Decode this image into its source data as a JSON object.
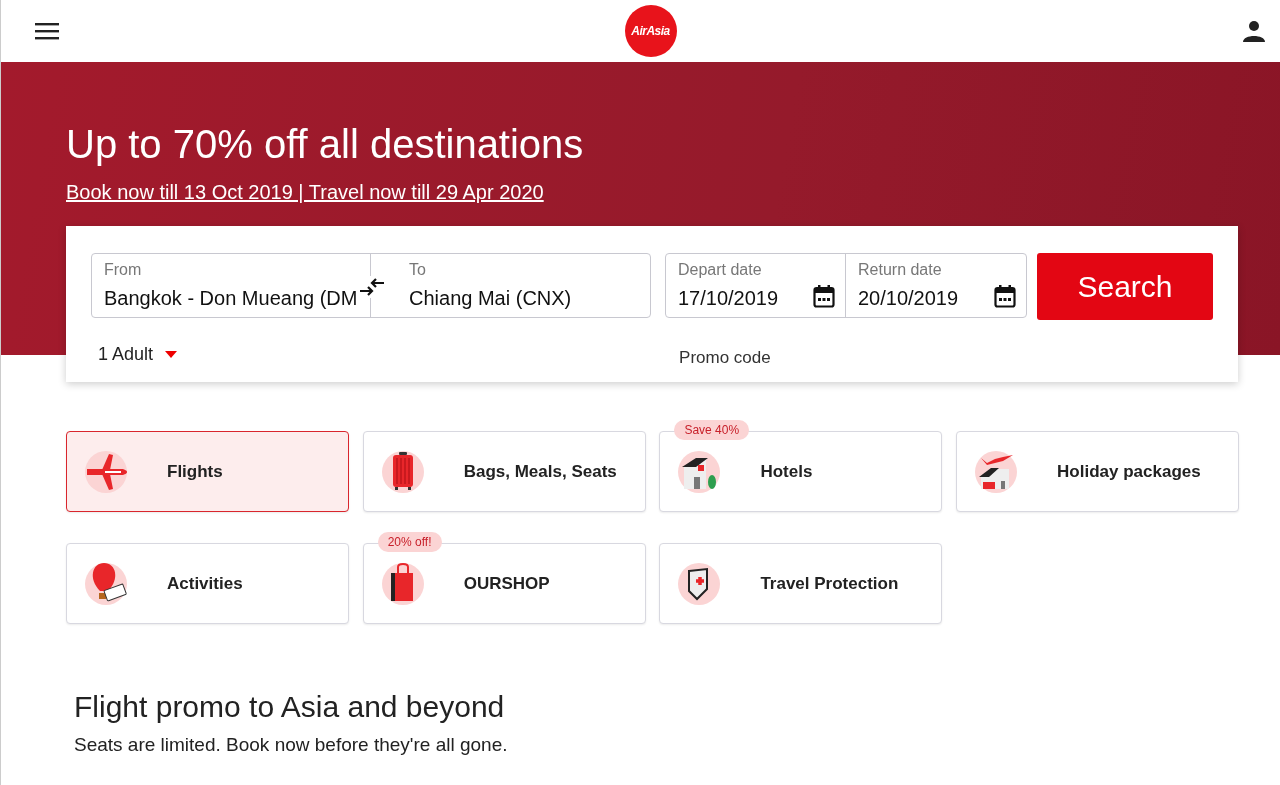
{
  "header": {
    "logo": "AirAsia"
  },
  "hero": {
    "title": "Up to 70% off all destinations",
    "subtitle_link": "Book now till 13 Oct 2019 | Travel now till 29 Apr 2020"
  },
  "search_form": {
    "fields": [
      {
        "kind": "place",
        "label": "From",
        "value": "Bangkok - Don Mueang (DM"
      },
      {
        "kind": "place",
        "label": "To",
        "value": "Chiang Mai (CNX)"
      },
      {
        "kind": "date",
        "label": "Depart date",
        "value": "17/10/2019"
      },
      {
        "kind": "date",
        "label": "Return date",
        "value": "20/10/2019"
      }
    ],
    "search_button": "Search",
    "passengers": "1 Adult",
    "promo_code": "Promo code"
  },
  "services": [
    {
      "label": "Flights",
      "kind": "plane",
      "selected": true
    },
    {
      "label": "Bags, Meals, Seats",
      "kind": "suitcase",
      "selected": false
    },
    {
      "label": "Hotels",
      "kind": "hotel",
      "selected": false,
      "badge": "Save 40%"
    },
    {
      "label": "Holiday packages",
      "kind": "holiday",
      "selected": false
    },
    {
      "label": "Activities",
      "kind": "balloon",
      "selected": false
    },
    {
      "label": "OURSHOP",
      "kind": "bag",
      "selected": false,
      "badge": "20% off!"
    },
    {
      "label": "Travel Protection",
      "kind": "shield",
      "selected": false
    }
  ],
  "promo_section": {
    "title": "Flight promo to Asia and beyond",
    "subtitle": "Seats are limited. Book now before they're all gone."
  }
}
